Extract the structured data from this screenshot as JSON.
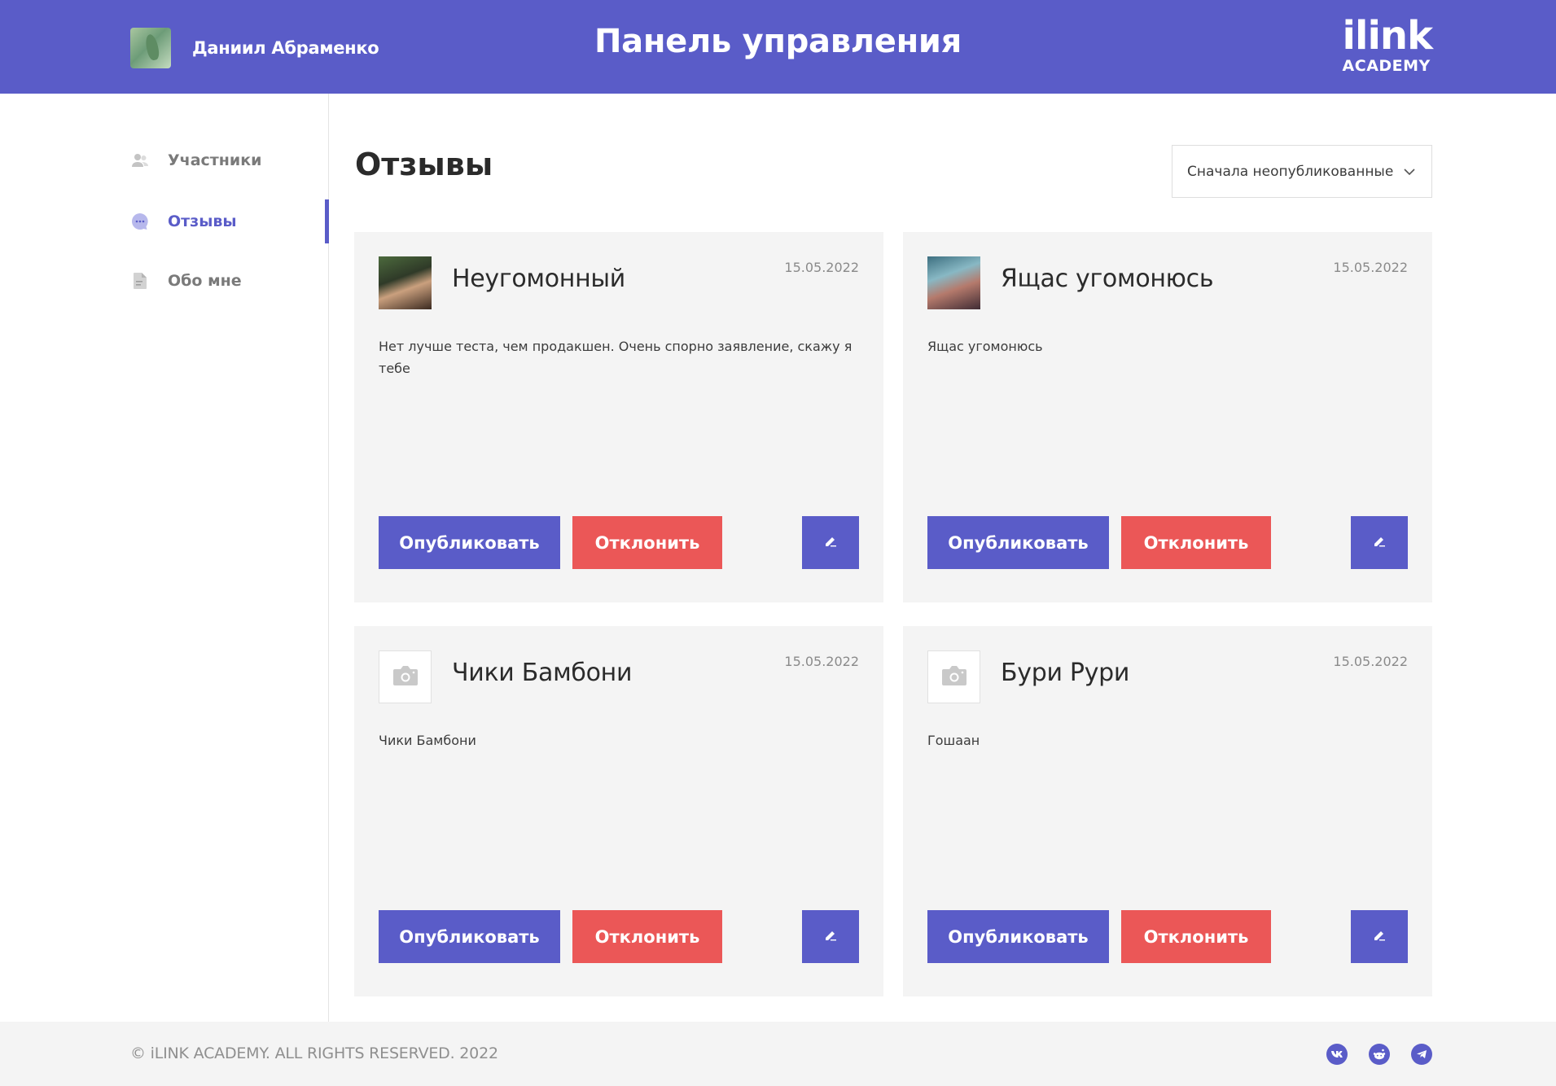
{
  "header": {
    "user_name": "Даниил Абраменко",
    "title": "Панель управления",
    "logo_main": "ilink",
    "logo_sub": "ACADEMY"
  },
  "sidebar": {
    "items": [
      {
        "label": "Участники",
        "icon": "users-icon",
        "active": false
      },
      {
        "label": "Отзывы",
        "icon": "chat-icon",
        "active": true
      },
      {
        "label": "Обо мне",
        "icon": "document-icon",
        "active": false
      }
    ]
  },
  "main": {
    "title": "Отзывы",
    "sort": {
      "value": "Сначала неопубликованные",
      "icon": "chevron-down-icon"
    }
  },
  "reviews": [
    {
      "name": "Неугомонный",
      "date": "15.05.2022",
      "text": "Нет лучше теста, чем продакшен. Очень спорно заявление, скажу я тебе",
      "avatar": "photo"
    },
    {
      "name": "Ящас угомонюсь",
      "date": "15.05.2022",
      "text": "Ящас угомонюсь",
      "avatar": "photo"
    },
    {
      "name": "Чики Бамбони",
      "date": "15.05.2022",
      "text": "Чики Бамбони",
      "avatar": "camera-icon"
    },
    {
      "name": "Бури Рури",
      "date": "15.05.2022",
      "text": "Гошаан",
      "avatar": "camera-icon"
    }
  ],
  "buttons": {
    "publish": "Опубликовать",
    "reject": "Отклонить",
    "edit_icon": "pencil-icon"
  },
  "footer": {
    "copyright": "© iLINK ACADEMY. ALL RIGHTS RESERVED. 2022",
    "socials": [
      "vk-icon",
      "reddit-icon",
      "telegram-icon"
    ]
  },
  "colors": {
    "accent": "#5a5cc8",
    "danger": "#eb5757",
    "card_bg": "#f4f4f4"
  }
}
